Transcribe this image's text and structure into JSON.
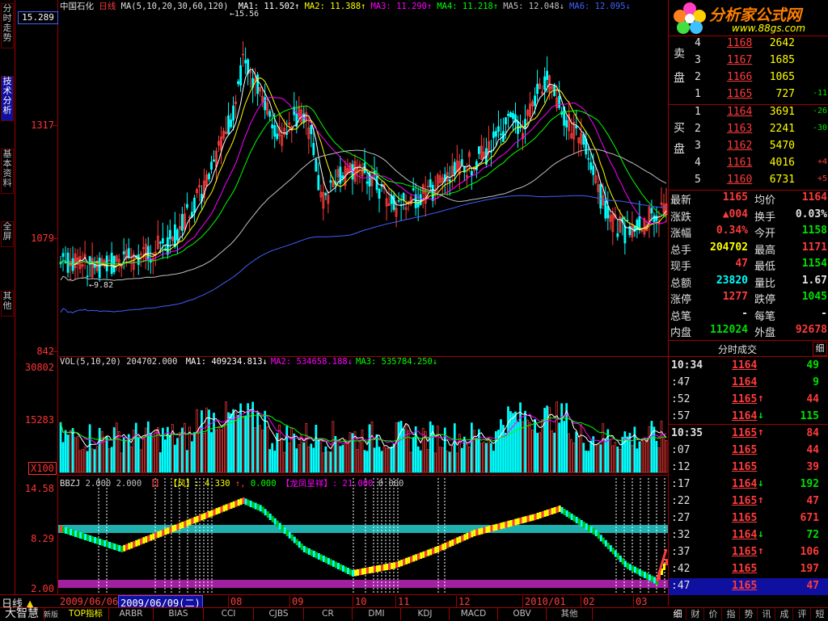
{
  "header": {
    "stock_name": "中国石化",
    "period": "日线",
    "ma_label": "MA(5,10,20,30,60,120)",
    "ma_values": [
      {
        "name": "MA1:",
        "value": "11.502",
        "arrow": "↑",
        "color": "#ffffff"
      },
      {
        "name": "MA2:",
        "value": "11.388",
        "arrow": "↑",
        "color": "#ffff00"
      },
      {
        "name": "MA3:",
        "value": "11.290",
        "arrow": "↑",
        "color": "#ff00ff"
      },
      {
        "name": "MA4:",
        "value": "11.218",
        "arrow": "↑",
        "color": "#00ff00"
      },
      {
        "name": "MA5:",
        "value": "12.048",
        "arrow": "↓",
        "color": "#c0c0c0"
      },
      {
        "name": "MA6:",
        "value": "12.095",
        "arrow": "↓",
        "color": "#4060ff"
      }
    ],
    "current_price_box": "15.289",
    "high_marker": "15.56",
    "low_marker": "9.82"
  },
  "left_tabs": [
    {
      "label": "分时走势",
      "active": false
    },
    {
      "label": "技术分析",
      "active": true
    },
    {
      "label": "基本资料",
      "active": false
    },
    {
      "label": "全屏",
      "active": false
    },
    {
      "label": "其他",
      "active": false
    }
  ],
  "price_axis": [
    "1317",
    "1079",
    "842"
  ],
  "vol_axis": [
    "30802",
    "15283"
  ],
  "vol_multiplier": "X100",
  "ind_axis": [
    "14.58",
    "8.29",
    "2.00"
  ],
  "vol_legend": {
    "label": "VOL(5,10,20)",
    "vol": "204702.000",
    "items": [
      {
        "name": "MA1:",
        "value": "409234.813",
        "arrow": "↓",
        "color": "#ffffff"
      },
      {
        "name": "MA2:",
        "value": "534658.188",
        "arrow": "↓",
        "color": "#ff00ff"
      },
      {
        "name": "MA3:",
        "value": "535784.250",
        "arrow": "↓",
        "color": "#00ff00"
      }
    ]
  },
  "ind_legend": {
    "label": "BBZJ",
    "v1": "2.000",
    "v2": "2.000",
    "feng": "4.330",
    "v3": "0.000",
    "dragon": "龙凤呈祥",
    "v4": "21.000",
    "v5": "0.000"
  },
  "date_axis": {
    "period_btn": "日线",
    "left_date": "2009/06/06",
    "cursor_date": "2009/06/09(二)",
    "months": [
      "08",
      "09",
      "10",
      "11",
      "12",
      "2010/01",
      "02",
      "03"
    ]
  },
  "logo": {
    "brand": "分析家公式网",
    "url": "www.88gs.com"
  },
  "orderbook": {
    "sell_label": [
      "卖",
      "盘"
    ],
    "buy_label": [
      "买",
      "盘"
    ],
    "sell": [
      {
        "level": "4",
        "price": "1168",
        "vol": "2642",
        "chg": ""
      },
      {
        "level": "3",
        "price": "1167",
        "vol": "1685",
        "chg": ""
      },
      {
        "level": "2",
        "price": "1166",
        "vol": "1065",
        "chg": ""
      },
      {
        "level": "1",
        "price": "1165",
        "vol": "727",
        "chg": "-11"
      }
    ],
    "buy": [
      {
        "level": "1",
        "price": "1164",
        "vol": "3691",
        "chg": "-26"
      },
      {
        "level": "2",
        "price": "1163",
        "vol": "2241",
        "chg": "-30"
      },
      {
        "level": "3",
        "price": "1162",
        "vol": "5470",
        "chg": ""
      },
      {
        "level": "4",
        "price": "1161",
        "vol": "4016",
        "chg": "+4"
      },
      {
        "level": "5",
        "price": "1160",
        "vol": "6731",
        "chg": "+5"
      }
    ]
  },
  "quote": [
    {
      "l1": "最新",
      "v1": "1165",
      "c1": "red",
      "l2": "均价",
      "v2": "1164",
      "c2": "red"
    },
    {
      "l1": "涨跌",
      "v1": "▲004",
      "c1": "red",
      "l2": "换手",
      "v2": "0.03%",
      "c2": "wht"
    },
    {
      "l1": "涨幅",
      "v1": "0.34%",
      "c1": "red",
      "l2": "今开",
      "v2": "1158",
      "c2": "grn"
    },
    {
      "l1": "总手",
      "v1": "204702",
      "c1": "yel",
      "l2": "最高",
      "v2": "1171",
      "c2": "red"
    },
    {
      "l1": "现手",
      "v1": "47",
      "c1": "red",
      "l2": "最低",
      "v2": "1154",
      "c2": "grn"
    },
    {
      "l1": "总额",
      "v1": "23820",
      "c1": "cyan",
      "l2": "量比",
      "v2": "1.67",
      "c2": "wht"
    },
    {
      "l1": "涨停",
      "v1": "1277",
      "c1": "red",
      "l2": "跌停",
      "v2": "1045",
      "c2": "grn"
    },
    {
      "l1": "总笔",
      "v1": "-",
      "c1": "wht",
      "l2": "每笔",
      "v2": "-",
      "c2": "wht"
    },
    {
      "l1": "内盘",
      "v1": "112024",
      "c1": "grn",
      "l2": "外盘",
      "v2": "92678",
      "c2": "red"
    }
  ],
  "ticks_header": "分时成交",
  "ticks_detail_btn": "细",
  "ticks": [
    {
      "time": "10:34",
      "price": "1164",
      "arrow": "",
      "vol": "49",
      "vc": "grn",
      "bold": true
    },
    {
      "time": ":47",
      "price": "1164",
      "arrow": "",
      "vol": "9",
      "vc": "grn",
      "bold": false
    },
    {
      "time": ":52",
      "price": "1165",
      "arrow": "↑",
      "vol": "44",
      "vc": "red",
      "bold": false
    },
    {
      "time": ":57",
      "price": "1164",
      "arrow": "↓",
      "vol": "115",
      "vc": "grn",
      "bold": false
    },
    {
      "time": "10:35",
      "price": "1165",
      "arrow": "↑",
      "vol": "84",
      "vc": "red",
      "bold": true
    },
    {
      "time": ":07",
      "price": "1165",
      "arrow": "",
      "vol": "44",
      "vc": "red",
      "bold": false
    },
    {
      "time": ":12",
      "price": "1165",
      "arrow": "",
      "vol": "39",
      "vc": "red",
      "bold": false
    },
    {
      "time": ":17",
      "price": "1164",
      "arrow": "↓",
      "vol": "192",
      "vc": "grn",
      "bold": false
    },
    {
      "time": ":22",
      "price": "1165",
      "arrow": "↑",
      "vol": "47",
      "vc": "red",
      "bold": false
    },
    {
      "time": ":27",
      "price": "1165",
      "arrow": "",
      "vol": "671",
      "vc": "red",
      "bold": false
    },
    {
      "time": ":32",
      "price": "1164",
      "arrow": "↓",
      "vol": "72",
      "vc": "grn",
      "bold": false
    },
    {
      "time": ":37",
      "price": "1165",
      "arrow": "↑",
      "vol": "106",
      "vc": "red",
      "bold": false
    },
    {
      "time": ":42",
      "price": "1165",
      "arrow": "",
      "vol": "197",
      "vc": "red",
      "bold": false
    },
    {
      "time": ":47",
      "price": "1165",
      "arrow": "",
      "vol": "47",
      "vc": "red",
      "bold": false
    }
  ],
  "bottom_tabs": [
    "大智慧",
    "TOP指标",
    "ARBR",
    "BIAS",
    "CCI",
    "CJBS",
    "CR",
    "DMI",
    "KDJ",
    "MACD",
    "OBV",
    "其他"
  ],
  "bottom_tab_prefix": "新版",
  "right_tabs": [
    "细",
    "财",
    "价",
    "指",
    "势",
    "讯",
    "成",
    "评",
    "短"
  ],
  "colors": {
    "up": "#ff3b3b",
    "down": "#00ffff",
    "frame": "#a00000",
    "ma1": "#ffffff",
    "ma2": "#ffff00",
    "ma3": "#ff00ff",
    "ma4": "#00ff00",
    "ma5": "#c0c0c0",
    "ma6": "#4060ff",
    "band_cyan": "#20b0b0",
    "band_magenta": "#a020a0"
  }
}
